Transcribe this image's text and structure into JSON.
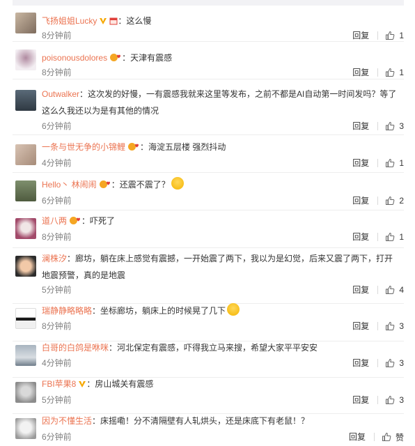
{
  "comments": [
    {
      "user": "飞扬姐姐Lucky",
      "badges": [
        "v",
        "gift"
      ],
      "text": "：这么慢",
      "time": "8分钟前",
      "reply": "回复",
      "likes": "1",
      "emoji": ""
    },
    {
      "user": "poisonousdolores",
      "badges": [
        "love"
      ],
      "text": "：天津有震感",
      "time": "8分钟前",
      "reply": "回复",
      "likes": "1",
      "emoji": ""
    },
    {
      "user": "Outwalker",
      "badges": [],
      "text": "：这次发的好慢，一有震感我就来这里等发布，之前不都是AI自动第一时间发吗？等了这么久我还以为是有其他的情况",
      "time": "6分钟前",
      "reply": "回复",
      "likes": "3",
      "emoji": ""
    },
    {
      "user": "一条与世无争的小锦鲤",
      "badges": [
        "love"
      ],
      "text": "：海淀五层楼 强烈抖动",
      "time": "4分钟前",
      "reply": "回复",
      "likes": "1",
      "emoji": ""
    },
    {
      "user": "Hello丶 林闹闹",
      "badges": [
        "love"
      ],
      "text": "：还震不震了？",
      "time": "6分钟前",
      "reply": "回复",
      "likes": "2",
      "emoji": "crying"
    },
    {
      "user": "道八两",
      "badges": [
        "love"
      ],
      "text": "：吓死了",
      "time": "8分钟前",
      "reply": "回复",
      "likes": "1",
      "emoji": ""
    },
    {
      "user": "澜株汐",
      "badges": [],
      "text": "：廊坊，躺在床上感觉有震撼，一开始震了两下，我以为是幻觉，后来又震了两下，打开地震预警，真的是地震",
      "time": "5分钟前",
      "reply": "回复",
      "likes": "4",
      "emoji": ""
    },
    {
      "user": "瑞静静略略略",
      "badges": [],
      "text": "：坐标廊坊，躺床上的时候晃了几下",
      "time": "8分钟前",
      "reply": "回复",
      "likes": "3",
      "emoji": "laughing"
    },
    {
      "user": "白哥的白鸽是咻咪",
      "badges": [],
      "text": "：河北保定有震感，吓得我立马来搜，希望大家平平安安",
      "time": "4分钟前",
      "reply": "回复",
      "likes": "3",
      "emoji": ""
    },
    {
      "user": "FBI苹果8",
      "badges": [
        "v"
      ],
      "text": "：房山城关有震感",
      "time": "5分钟前",
      "reply": "回复",
      "likes": "3",
      "emoji": ""
    },
    {
      "user": "因为不懂生活",
      "badges": [],
      "text": "：床摇嘞！分不清隔壁有人轧烘头，还是床底下有老鼠！？",
      "time": "6分钟前",
      "reply": "回复",
      "likes": "赞",
      "emoji": ""
    }
  ],
  "colors": {
    "username": "#eb7350",
    "text": "#333333",
    "time": "#808080",
    "divider": "#ededed",
    "vip": "#f6a800"
  }
}
